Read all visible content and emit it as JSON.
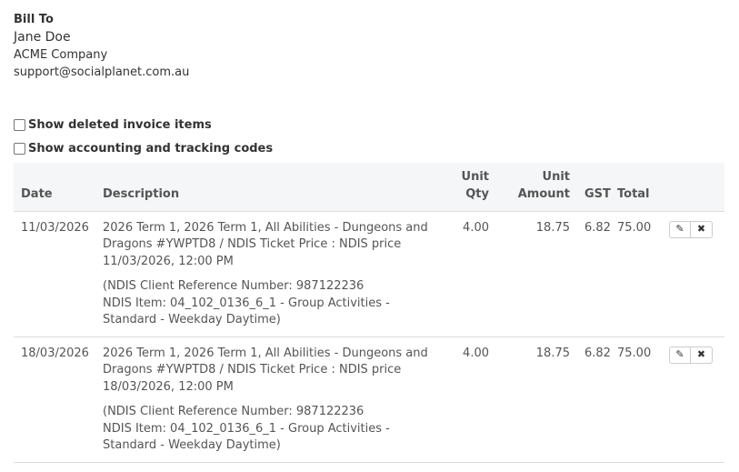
{
  "bill_to": {
    "heading": "Bill To",
    "name": "Jane Doe",
    "company": "ACME Company",
    "email": "support@socialplanet.com.au"
  },
  "options": {
    "show_deleted": "Show deleted invoice items",
    "show_codes": "Show accounting and tracking codes"
  },
  "table": {
    "headers": {
      "date": "Date",
      "description": "Description",
      "unit_qty_1": "Unit",
      "unit_qty_2": "Qty",
      "unit_amount_1": "Unit",
      "unit_amount_2": "Amount",
      "gst": "GST",
      "total": "Total"
    },
    "rows": [
      {
        "date": "11/03/2026",
        "desc_main": "2026 Term 1, 2026 Term 1, All Abilities - Dungeons and Dragons #YWPTD8 / NDIS Ticket Price : NDIS price 11/03/2026, 12:00 PM",
        "desc_ndis_ref": "(NDIS Client Reference Number: 987122236",
        "desc_ndis_item": "NDIS Item: 04_102_0136_6_1 - Group Activities - Standard - Weekday Daytime)",
        "qty": "4.00",
        "unit_amount": "18.75",
        "gst": "6.82",
        "total": "75.00"
      },
      {
        "date": "18/03/2026",
        "desc_main": "2026 Term 1, 2026 Term 1, All Abilities - Dungeons and Dragons #YWPTD8 / NDIS Ticket Price : NDIS price 18/03/2026, 12:00 PM",
        "desc_ndis_ref": "(NDIS Client Reference Number: 987122236",
        "desc_ndis_item": "NDIS Item: 04_102_0136_6_1 - Group Activities - Standard - Weekday Daytime)",
        "qty": "4.00",
        "unit_amount": "18.75",
        "gst": "6.82",
        "total": "75.00"
      }
    ],
    "row_actions": {
      "edit": "✎",
      "delete": "✖"
    }
  }
}
